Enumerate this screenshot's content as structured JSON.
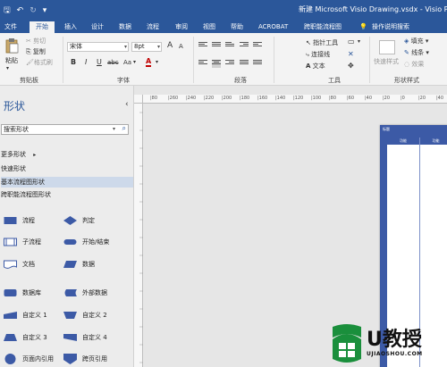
{
  "title_bar": {
    "title": "新建 Microsoft Visio Drawing.vsdx  -  Visio Pro"
  },
  "tabs": [
    "文件",
    "开始",
    "插入",
    "设计",
    "数据",
    "流程",
    "审阅",
    "视图",
    "帮助",
    "ACROBAT",
    "跨职能流程图",
    "操作说明搜索"
  ],
  "active_tab": "开始",
  "ribbon": {
    "clipboard": {
      "paste": "粘贴",
      "cut": "剪切",
      "copy": "复制",
      "format_painter": "格式刷",
      "label": "剪贴板"
    },
    "font": {
      "family": "宋体",
      "size": "8pt",
      "bold": "B",
      "italic": "I",
      "underline": "U",
      "strike": "abc",
      "grow": "A",
      "shrink": "A",
      "aa": "Aa",
      "label": "字体"
    },
    "paragraph": {
      "label": "段落"
    },
    "tools": {
      "pointer": "指针工具",
      "connector": "连接线",
      "text": "文本",
      "label": "工具"
    },
    "shape_styles": {
      "quick_styles": "快速样式",
      "fill": "填充",
      "line": "线条",
      "effects": "效果",
      "label": "形状样式"
    }
  },
  "shapes_panel": {
    "title": "形状",
    "search_placeholder": "搜索形状",
    "more_shapes": "更多形状",
    "quick_shapes": "快速形状",
    "basic_flowchart": "基本流程图形状",
    "cross_functional": "跨职能流程图形状",
    "stencils": [
      {
        "label": "流程",
        "icon": "process-rect"
      },
      {
        "label": "判定",
        "icon": "decision-diamond"
      },
      {
        "label": "子流程",
        "icon": "subprocess-rect"
      },
      {
        "label": "开始/结束",
        "icon": "terminator-pill"
      },
      {
        "label": "文档",
        "icon": "document-shape"
      },
      {
        "label": "数据",
        "icon": "data-parallelogram"
      },
      {
        "label": "数据库",
        "icon": "database-shape"
      },
      {
        "label": "外部数据",
        "icon": "external-data-shape"
      },
      {
        "label": "自定义 1",
        "icon": "custom1-shape"
      },
      {
        "label": "自定义 2",
        "icon": "custom2-shape"
      },
      {
        "label": "自定义 3",
        "icon": "custom3-shape"
      },
      {
        "label": "自定义 4",
        "icon": "custom4-shape"
      },
      {
        "label": "页面内引用",
        "icon": "on-page-ref-circle"
      },
      {
        "label": "跨页引用",
        "icon": "off-page-ref-shape"
      }
    ]
  },
  "ruler": {
    "ticks": [
      "|80",
      "|260",
      "|240",
      "|220",
      "|200",
      "|180",
      "|160",
      "|140",
      "|120",
      "|100",
      "|80",
      "|60",
      "|40",
      "|20",
      "|0",
      "|20",
      "|40"
    ]
  },
  "canvas": {
    "pool_title": "标题",
    "lanes": [
      "功能",
      "功能"
    ]
  },
  "watermark": {
    "brand": "U教授",
    "url": "UJIAOSHOU.COM"
  },
  "colors": {
    "accent": "#2b579a",
    "shape_fill": "#3c5aa6",
    "selected_row": "#cdd9ea"
  }
}
